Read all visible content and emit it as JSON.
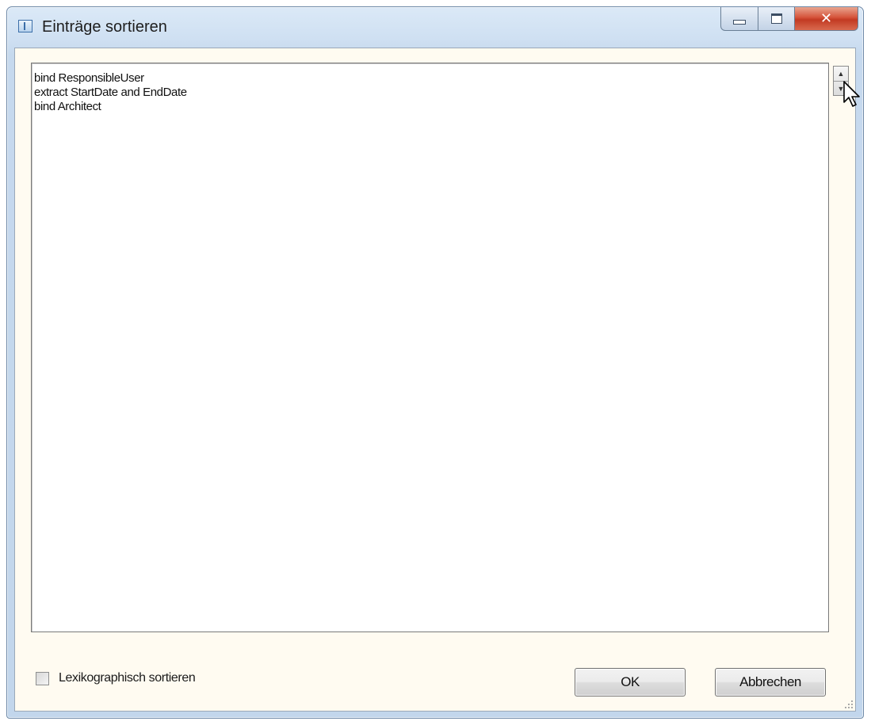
{
  "window": {
    "title": "Einträge sortieren"
  },
  "list": {
    "items": [
      "bind ResponsibleUser",
      "extract StartDate and EndDate",
      "bind Architect"
    ]
  },
  "options": {
    "lexicographic_label": "Lexikographisch sortieren",
    "lexicographic_checked": false
  },
  "buttons": {
    "ok_label": "OK",
    "cancel_label": "Abbrechen"
  },
  "icons": {
    "app": "window-icon",
    "minimize": "minimize-icon",
    "maximize": "maximize-icon",
    "close": "close-icon",
    "move_up": "arrow-up-icon",
    "move_down": "arrow-down-icon",
    "cursor": "mouse-pointer-icon",
    "resize": "resize-grip-icon"
  },
  "colors": {
    "title_bar": "#cfe0f2",
    "client_background": "#fffbf1",
    "close_button": "#c23a22"
  }
}
